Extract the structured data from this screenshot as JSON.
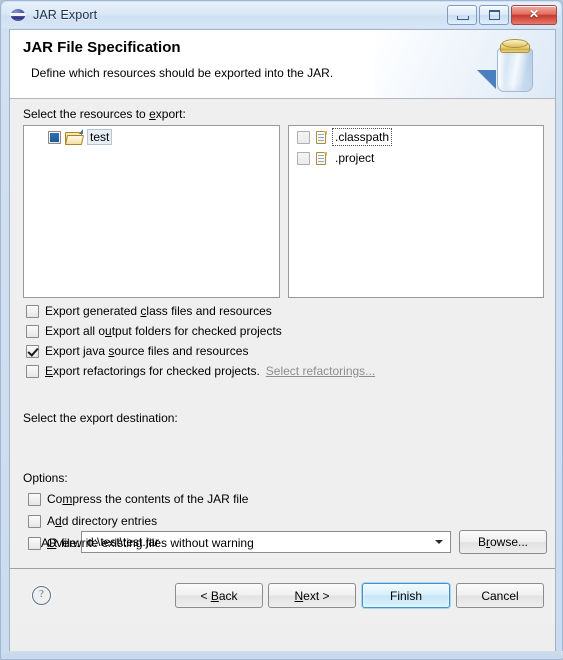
{
  "window": {
    "title": "JAR Export",
    "app_icon": "eclipse-sphere-icon",
    "buttons": {
      "minimize": "minimize-icon",
      "maximize": "maximize-icon",
      "close": "✕"
    }
  },
  "header": {
    "title": "JAR File Specification",
    "description": "Define which resources should be exported into the JAR.",
    "illustration": "jar-jar-export-icon"
  },
  "resources": {
    "label": "Select the resources to export:",
    "label_mnemonic": "e",
    "left_tree": [
      {
        "name": "test",
        "check_state": "partial",
        "icon": "open-folder-icon",
        "selected": true
      }
    ],
    "right_tree": [
      {
        "name": ".classpath",
        "check_state": "unchecked",
        "icon": "file-icon",
        "focused": true
      },
      {
        "name": ".project",
        "check_state": "unchecked",
        "icon": "file-icon",
        "focused": false
      }
    ]
  },
  "export_options": [
    {
      "label": "Export generated class files and resources",
      "checked": false,
      "enabled": true
    },
    {
      "label": "Export all output folders for checked projects",
      "checked": false,
      "enabled": true
    },
    {
      "label": "Export java source files and resources",
      "checked": true,
      "enabled": true
    },
    {
      "label": "Export refactorings for checked projects.",
      "checked": false,
      "enabled": true,
      "link": "Select refactorings...",
      "link_enabled": false
    }
  ],
  "destination": {
    "label": "Select the export destination:",
    "jar_file_label": "JAR file:",
    "jar_file_value": "d:\\test\\test.jar",
    "jar_file_placeholder": "",
    "browse_label": "Browse...",
    "dropdown_icon": "chevron-down-icon"
  },
  "options": {
    "label": "Options:",
    "items": [
      {
        "label": "Compress the contents of the JAR file",
        "checked": false
      },
      {
        "label": "Add directory entries",
        "checked": false
      },
      {
        "label": "Overwrite existing files without warning",
        "checked": false
      }
    ]
  },
  "footer": {
    "help_icon": "help-question-icon",
    "back_label": "< Back",
    "next_label": "Next >",
    "finish_label": "Finish",
    "cancel_label": "Cancel",
    "default_button": "Finish"
  },
  "colors": {
    "window_border": "#9db7d4",
    "titlebar_gradient_top": "#e8f0fa",
    "client_bg": "#efefef",
    "header_bg": "#ffffff",
    "close_button": "#c8392c",
    "default_button_border": "#3c93cf",
    "checkbox_partial_fill": "#2d6fb5",
    "link_disabled": "#8d8d8d"
  }
}
